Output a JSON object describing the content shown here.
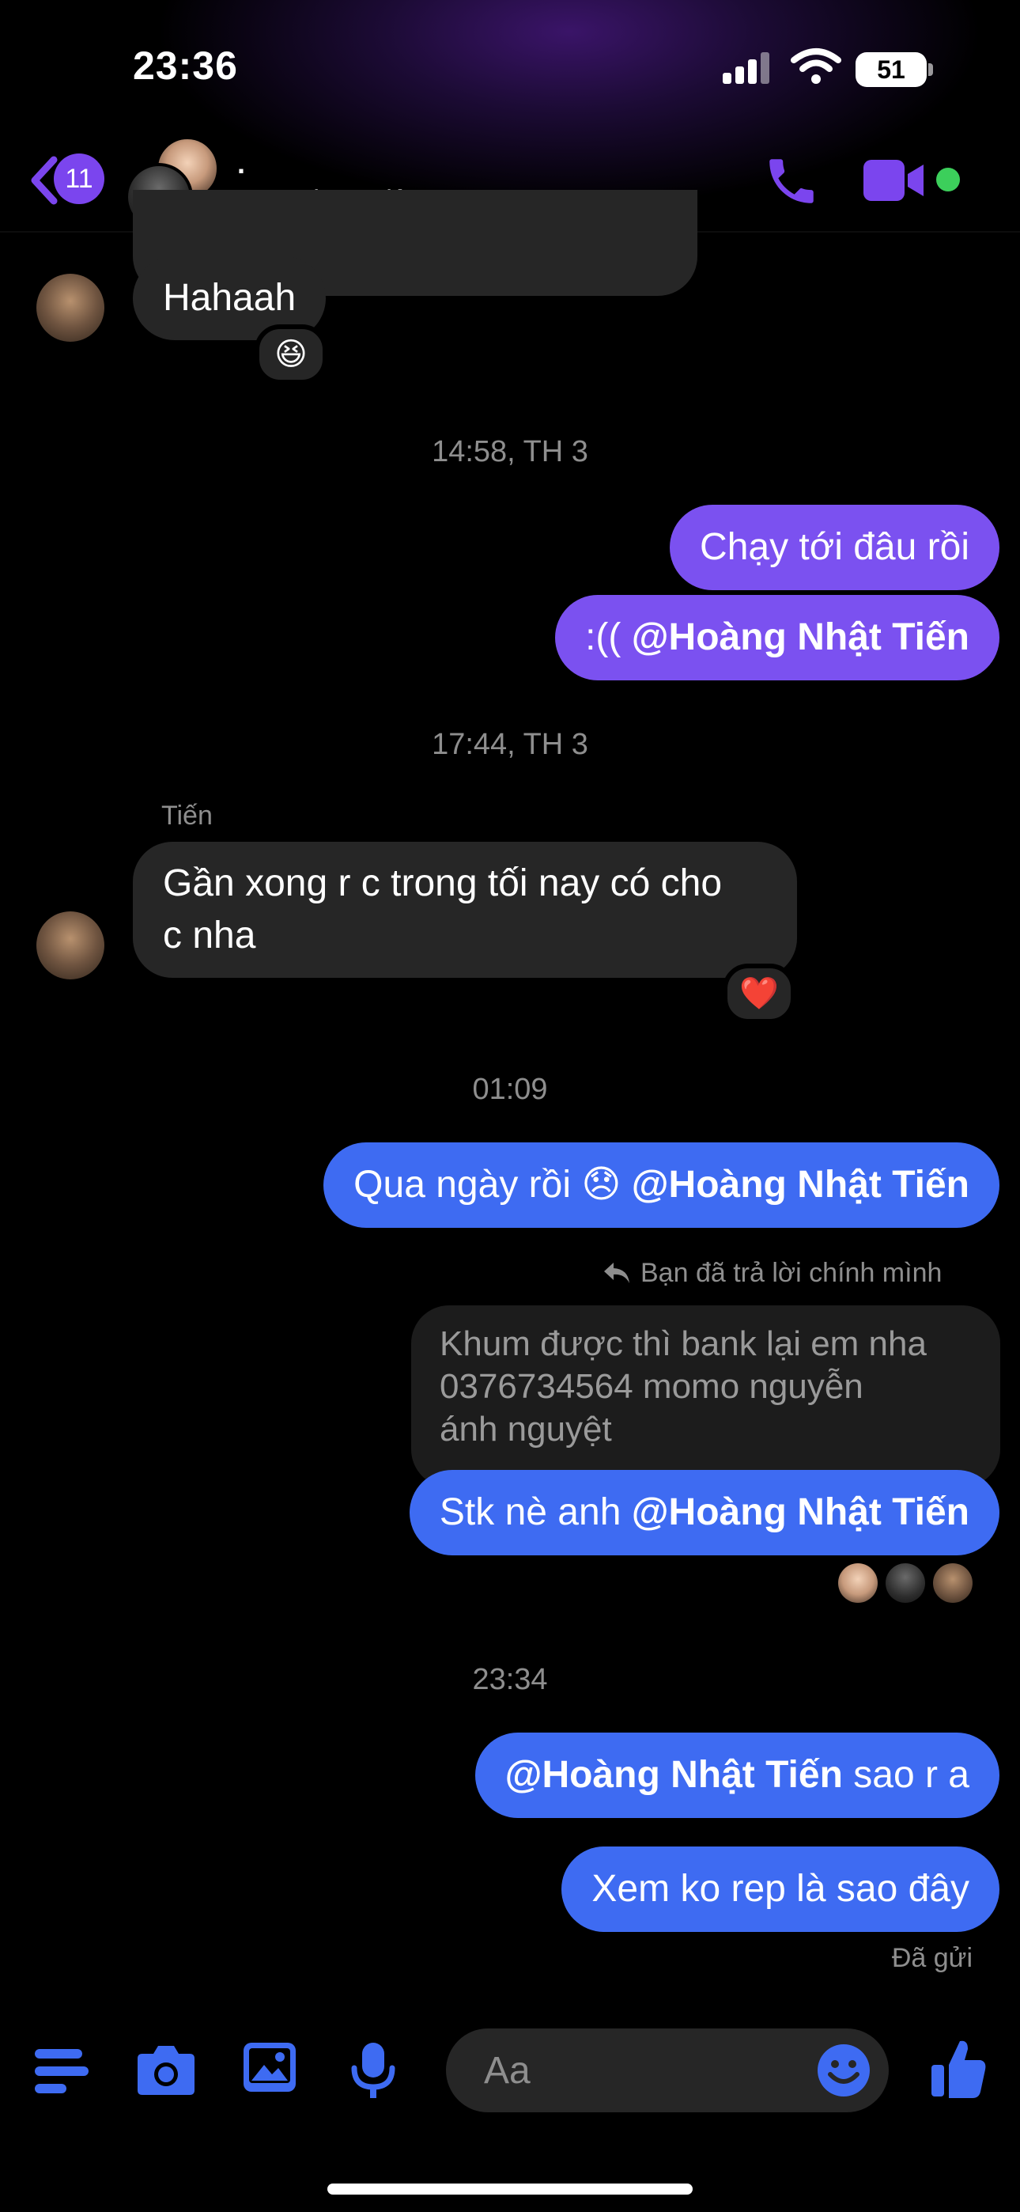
{
  "status_bar": {
    "time": "23:36",
    "battery": "51"
  },
  "header": {
    "back_count": "11",
    "title": ".",
    "status": "Đang hoạt động"
  },
  "messages": {
    "m1": "Hahaah",
    "ts1": "14:58, TH 3",
    "m2": "Chạy tới đâu rồi",
    "m3_prefix": ":((",
    "mention": "@Hoàng Nhật Tiến",
    "ts2": "17:44, TH 3",
    "sender2": "Tiến",
    "m4_line1": "Gần xong r c trong tối nay có cho",
    "m4_line2": "c nha",
    "ts3": "01:09",
    "m5_prefix": "Qua ngày rồi",
    "m5_emoji": "😞",
    "reply_note": "Bạn đã trả lời chính mình",
    "reply_line1": "Khum được thì bank lại em nha",
    "reply_line2": "0376734564 momo nguyễn",
    "reply_line3": "ánh nguyệt",
    "m6_prefix": "Stk nè anh",
    "ts4": "23:34",
    "m7_suffix": "sao r a",
    "m8": "Xem ko rep là sao đây",
    "sent_status": "Đã gửi"
  },
  "reactions": {
    "r1": "😆",
    "r2": "❤️"
  },
  "composer": {
    "placeholder": "Aa"
  },
  "colors": {
    "accent_purple": "#7b51f0",
    "accent_blue": "#3e6bf2",
    "bubble_in": "#262626",
    "active_green": "#3ccf5b"
  }
}
